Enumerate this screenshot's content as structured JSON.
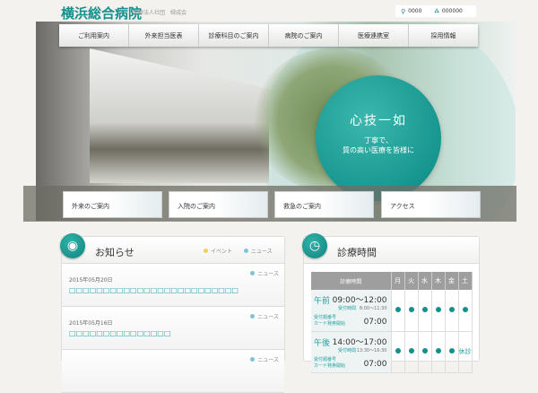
{
  "header": {
    "logo": "横浜総合病院",
    "subtitle": "医療法人社団　緑成会",
    "links": [
      {
        "icon": "map-pin-icon",
        "label": "0000"
      },
      {
        "icon": "sitemap-icon",
        "label": "000000"
      }
    ]
  },
  "nav": [
    "ご利用案内",
    "外来担当医表",
    "診療科目のご案内",
    "病院のご案内",
    "医療連携室",
    "採用情報"
  ],
  "hero": {
    "headline": "心技一如",
    "tagline_1": "丁寧で、",
    "tagline_2": "質の高い医療を皆様に"
  },
  "cards": [
    "外来のご案内",
    "入院のご案内",
    "救急のご案内",
    "アクセス"
  ],
  "news": {
    "title": "お知らせ",
    "legend": [
      {
        "label": "イベント",
        "color": "#f2cf5b"
      },
      {
        "label": "ニュース",
        "color": "#7fc4dc"
      }
    ],
    "items": [
      {
        "date": "2015年05月20日",
        "title": "□□□□□□□□□□□□□□□□□□□□□□□□□",
        "tag": "ニュース"
      },
      {
        "date": "2015年05月16日",
        "title": "□□□□□□□□□□□□□□□",
        "tag": "ニュース"
      },
      {
        "date": "",
        "title": "",
        "tag": "ニュース"
      }
    ]
  },
  "hours": {
    "title": "診療時間",
    "header": "診療時間",
    "days": [
      "月",
      "火",
      "水",
      "木",
      "金",
      "土"
    ],
    "rows": [
      {
        "label": "午前",
        "time": "09:00〜12:00",
        "reception_label": "受付時間",
        "reception": "8:00〜11:30",
        "card_label_1": "受付順番号",
        "card_label_2": "カード発券開始",
        "card_time": "07:00",
        "marks": [
          1,
          1,
          1,
          1,
          1,
          1
        ],
        "sat_text": ""
      },
      {
        "label": "午後",
        "time": "14:00〜17:00",
        "reception_label": "受付時間",
        "reception": "13:30〜16:30",
        "card_label_1": "受付順番号",
        "card_label_2": "カード発券開始",
        "card_time": "07:00",
        "marks": [
          1,
          1,
          1,
          1,
          1,
          0
        ],
        "sat_text": "休診"
      }
    ]
  }
}
